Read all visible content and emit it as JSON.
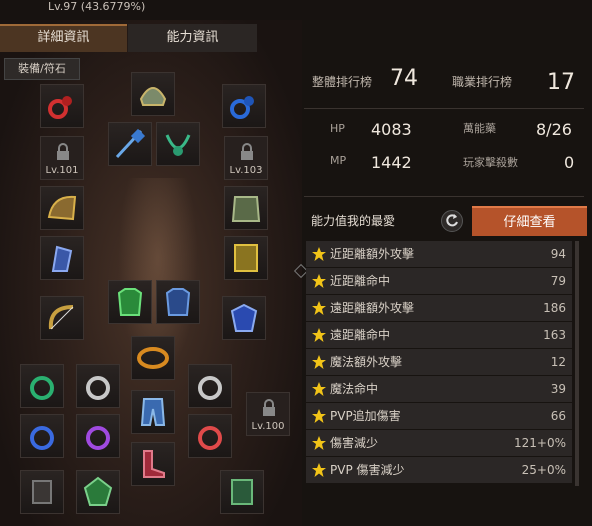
{
  "header": {
    "level_text": "Lv.97 (43.6779%)"
  },
  "tabs": [
    {
      "label": "詳細資訊"
    },
    {
      "label": "能力資訊"
    }
  ],
  "equipment": {
    "section_label": "裝備/符石",
    "locked_slots": [
      {
        "level": "Lv.101"
      },
      {
        "level": "Lv.103"
      },
      {
        "level": "Lv.100"
      }
    ]
  },
  "rankings": {
    "overall_label": "整體排行榜",
    "overall_value": "74",
    "class_label": "職業排行榜",
    "class_value": "17"
  },
  "stats": {
    "hp_label": "HP",
    "hp_value": "4083",
    "mp_label": "MP",
    "mp_value": "1442",
    "elixir_label": "萬能藥",
    "elixir_value": "8/26",
    "pk_label": "玩家擊殺數",
    "pk_value": "0"
  },
  "favorites": {
    "title": "能力值我的最愛",
    "detail_button": "仔細查看",
    "items": [
      {
        "name": "近距離額外攻擊",
        "value": "94"
      },
      {
        "name": "近距離命中",
        "value": "79"
      },
      {
        "name": "遠距離額外攻擊",
        "value": "186"
      },
      {
        "name": "遠距離命中",
        "value": "163"
      },
      {
        "name": "魔法額外攻擊",
        "value": "12"
      },
      {
        "name": "魔法命中",
        "value": "39"
      },
      {
        "name": "PVP追加傷害",
        "value": "66"
      },
      {
        "name": "傷害減少",
        "value": "121+0%"
      },
      {
        "name": "PVP 傷害減少",
        "value": "25+0%"
      }
    ]
  },
  "colors": {
    "accent": "#b5532a",
    "tab_active": "#4c3522",
    "star": "#f2c418"
  }
}
